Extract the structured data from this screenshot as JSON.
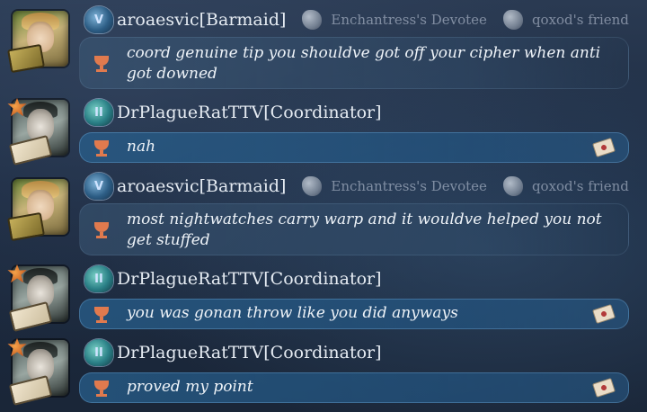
{
  "messages": [
    {
      "user": "aroaesvic[Barmaid]",
      "rank": "V",
      "tags": [
        "Enchantress's Devotee",
        "qoxod's friend"
      ],
      "text_lines": [
        "coord genuine tip you shouldve got off your cipher when anti",
        "got downed"
      ],
      "style": "plain"
    },
    {
      "user": "DrPlagueRatTTV[Coordinator]",
      "rank": "II",
      "tags": [],
      "text_lines": [
        "nah"
      ],
      "style": "blue"
    },
    {
      "user": "aroaesvic[Barmaid]",
      "rank": "V",
      "tags": [
        "Enchantress's Devotee",
        "qoxod's friend"
      ],
      "text_lines": [
        "most nightwatches carry warp and it wouldve helped you not",
        "get stuffed"
      ],
      "style": "plain"
    },
    {
      "user": "DrPlagueRatTTV[Coordinator]",
      "rank": "II",
      "tags": [],
      "text_lines": [
        "you was gonan throw like you did anyways"
      ],
      "style": "blue"
    },
    {
      "user": "DrPlagueRatTTV[Coordinator]",
      "rank": "II",
      "tags": [],
      "text_lines": [
        "proved my point"
      ],
      "style": "blue"
    }
  ],
  "colors": {
    "accent_blue": "#285f8c",
    "trophy": "#e07a4e",
    "text": "#eef3f8",
    "tag_text": "#c8d2e1"
  },
  "icons": [
    "rank-badge-icon",
    "trophy-icon",
    "envelope-icon",
    "stone-tag-icon"
  ]
}
